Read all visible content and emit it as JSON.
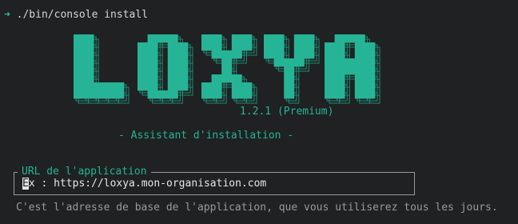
{
  "terminal": {
    "prompt_symbol": "➜",
    "command": "./bin/console install"
  },
  "logo": {
    "text": "LOXYA",
    "accent_color": "#26b496",
    "outline_color": "#1f8a72"
  },
  "header": {
    "version": "1.2.1 (Premium)",
    "subtitle": "- Assistant d'installation -"
  },
  "form": {
    "field_label": "URL de l'application",
    "cursor_char": "E",
    "placeholder_rest": "x : https://loxya.mon-organisation.com",
    "help_text": "C'est l'adresse de base de l'application, que vous utiliserez tous les jours."
  }
}
